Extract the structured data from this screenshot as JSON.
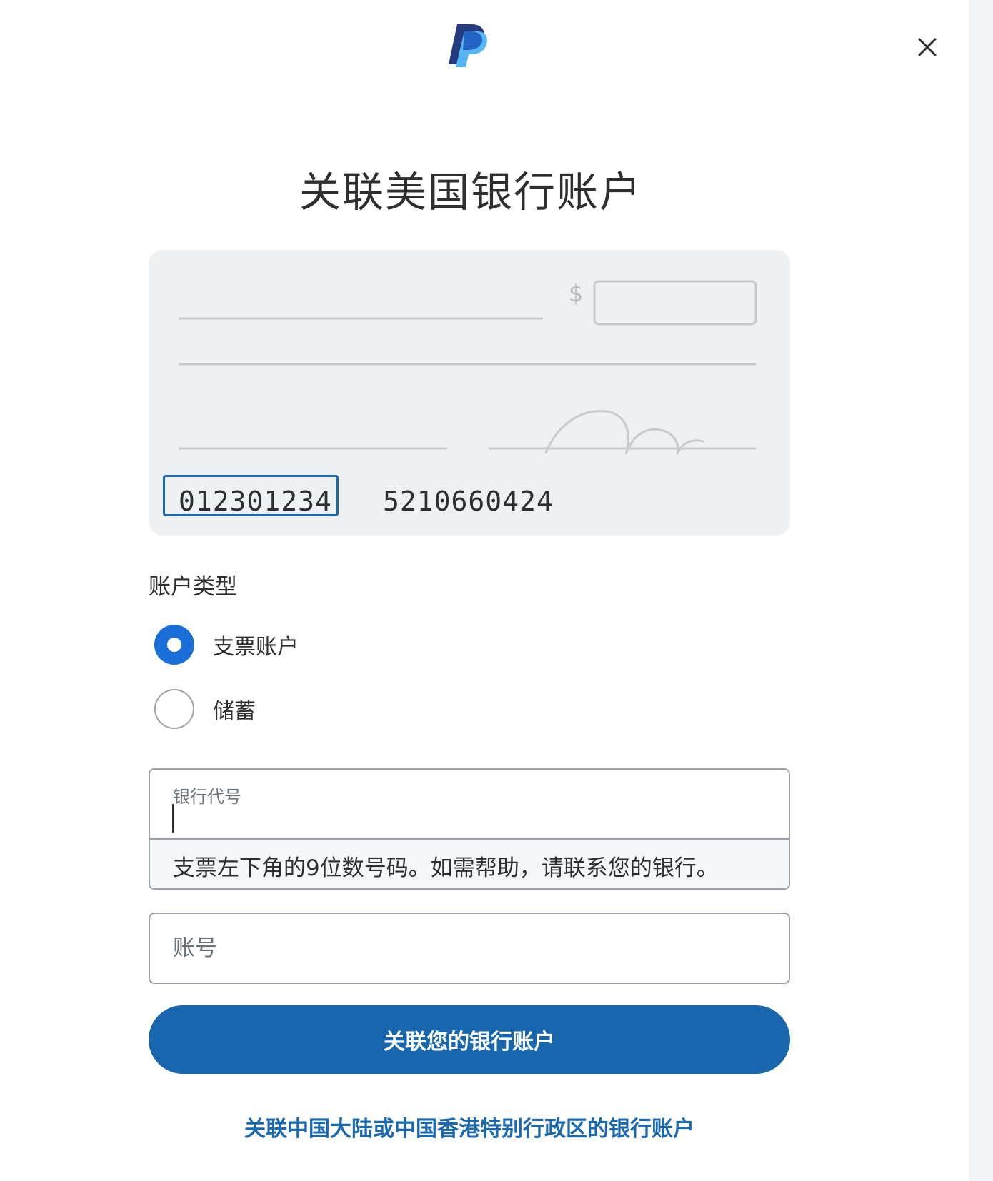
{
  "header": {
    "logo_icon": "paypal-logo",
    "close_icon": "close-icon"
  },
  "title": "关联美国银行账户",
  "check_illustration": {
    "currency_symbol": "$",
    "routing_number": "012301234",
    "account_number": "5210660424",
    "highlight_color": "#1a68b0"
  },
  "account_type": {
    "label": "账户类型",
    "options": [
      {
        "label": "支票账户",
        "selected": true
      },
      {
        "label": "储蓄",
        "selected": false
      }
    ]
  },
  "routing_field": {
    "label": "银行代号",
    "value": "",
    "helper": "支票左下角的9位数号码。如需帮助，请联系您的银行。"
  },
  "account_field": {
    "placeholder": "账号",
    "value": ""
  },
  "submit_label": "关联您的银行账户",
  "alt_link": "关联中国大陆或中国香港特别行政区的银行账户",
  "colors": {
    "primary": "#1866ad",
    "radio_selected": "#1a6ed8",
    "link": "#1a68b0"
  }
}
